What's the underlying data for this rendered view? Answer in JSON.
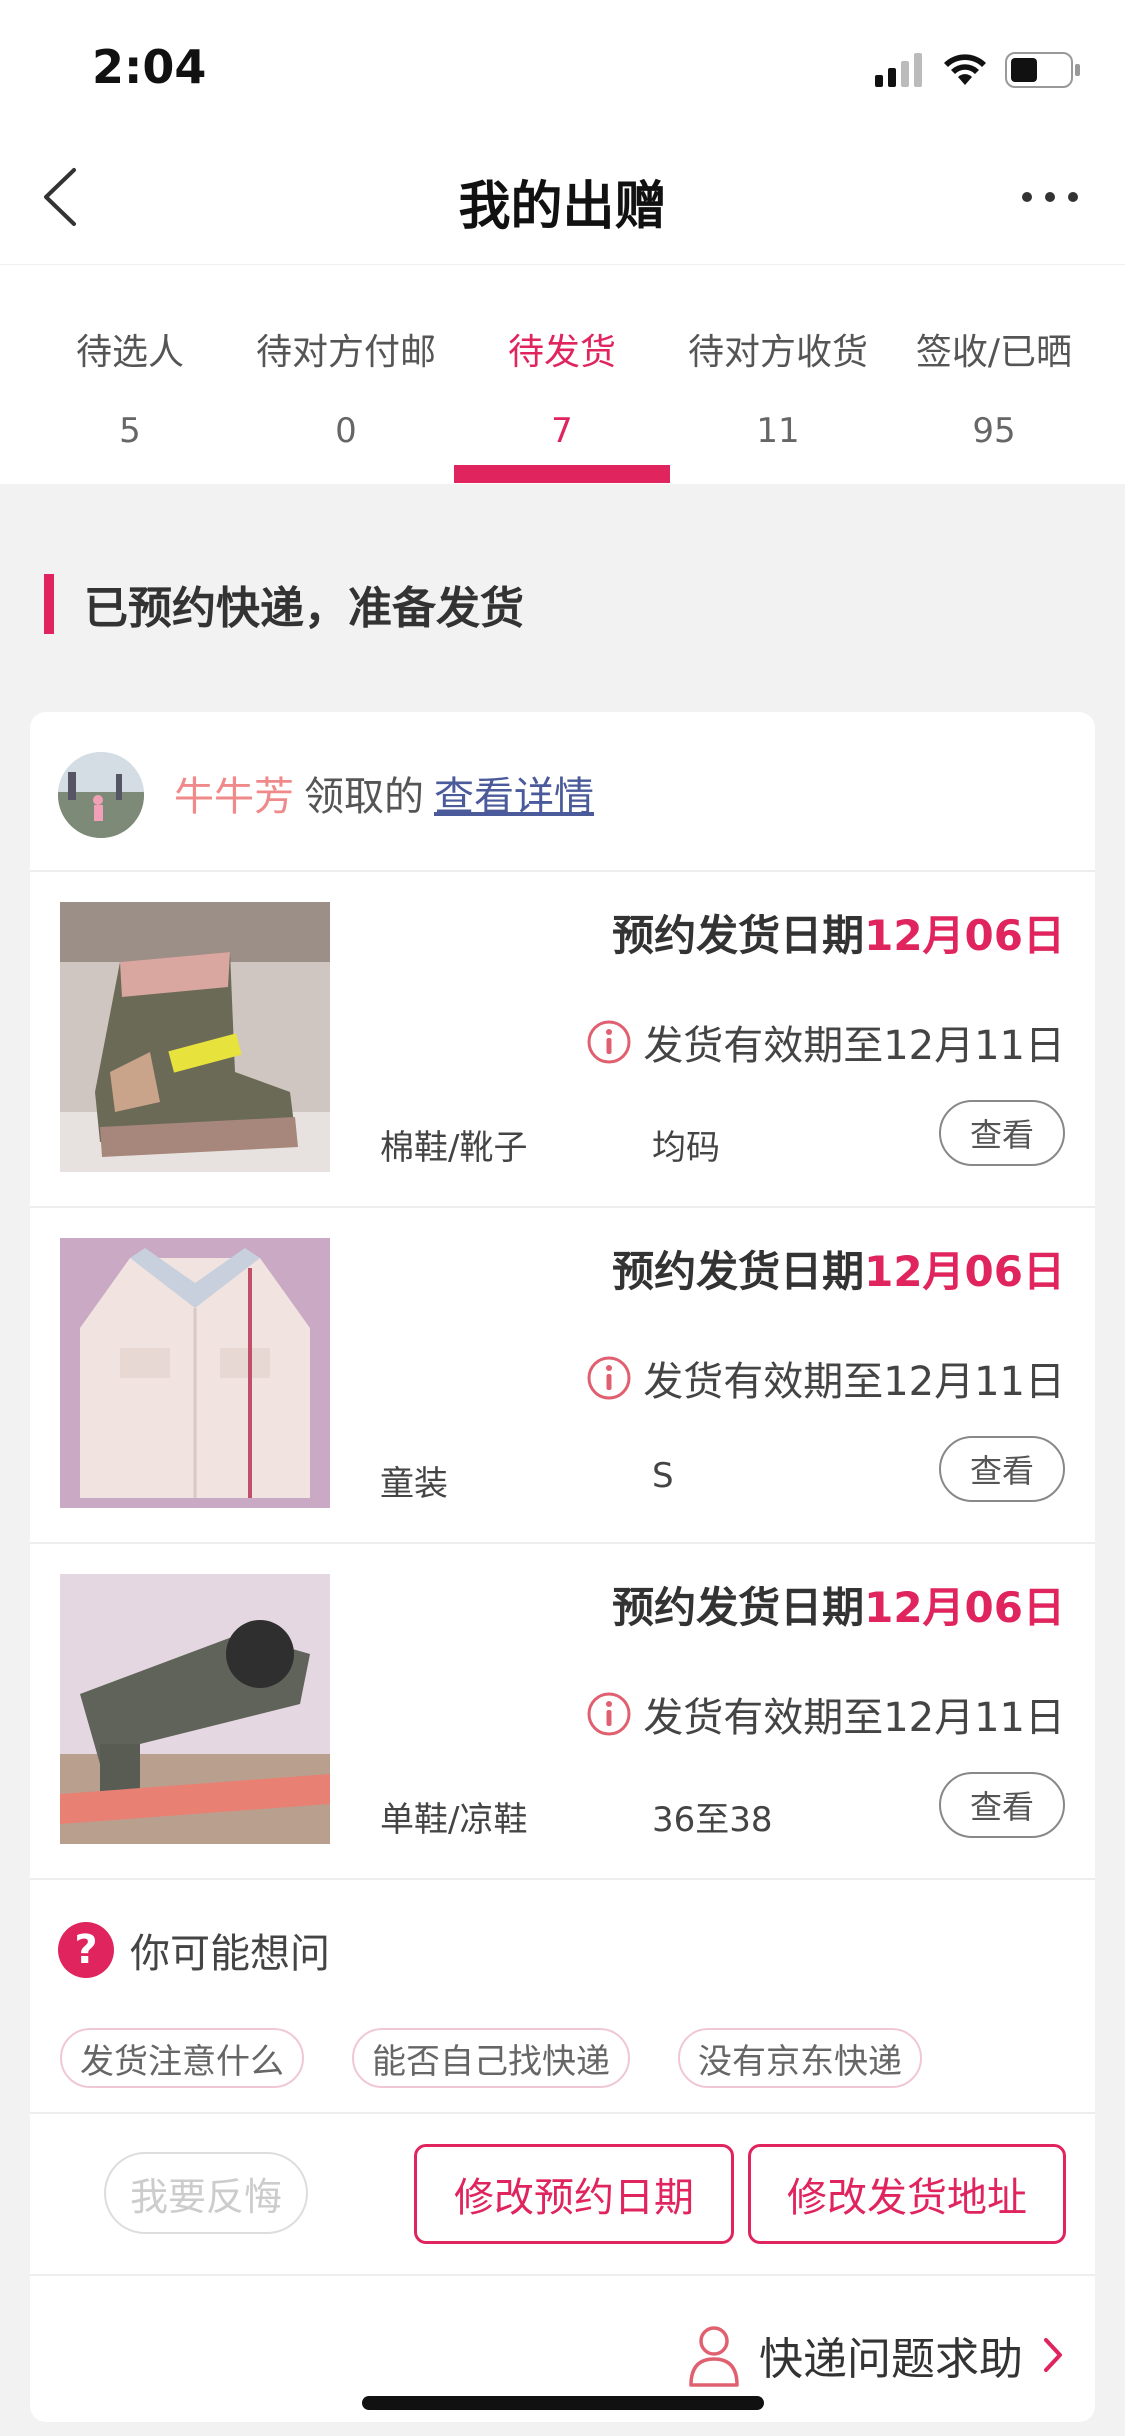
{
  "status_bar": {
    "time": "2:04"
  },
  "nav": {
    "title": "我的出赠"
  },
  "tabs": [
    {
      "label": "待选人",
      "count": "5"
    },
    {
      "label": "待对方付邮",
      "count": "0"
    },
    {
      "label": "待发货",
      "count": "7"
    },
    {
      "label": "待对方收货",
      "count": "11"
    },
    {
      "label": "签收/已晒",
      "count": "95"
    }
  ],
  "section": {
    "title": "已预约快递，准备发货"
  },
  "recipient": {
    "name": "牛牛芳",
    "verb": "领取的",
    "link": "查看详情"
  },
  "items": [
    {
      "ship_label": "预约发货日期",
      "ship_date": "12月06日",
      "validity": "发货有效期至12月11日",
      "category": "棉鞋/靴子",
      "size": "均码",
      "view": "查看"
    },
    {
      "ship_label": "预约发货日期",
      "ship_date": "12月06日",
      "validity": "发货有效期至12月11日",
      "category": "童装",
      "size": "S",
      "view": "查看"
    },
    {
      "ship_label": "预约发货日期",
      "ship_date": "12月06日",
      "validity": "发货有效期至12月11日",
      "category": "单鞋/凉鞋",
      "size": "36至38",
      "view": "查看"
    }
  ],
  "faq": {
    "title": "你可能想问",
    "chips": [
      "发货注意什么",
      "能否自己找快递",
      "没有京东快递"
    ]
  },
  "actions": {
    "regret": "我要反悔",
    "change_date": "修改预约日期",
    "change_address": "修改发货地址"
  },
  "help": {
    "label": "快递问题求助"
  },
  "colors": {
    "accent": "#e0245e",
    "link": "#4a5a9a",
    "recipient": "#f08a8a"
  }
}
